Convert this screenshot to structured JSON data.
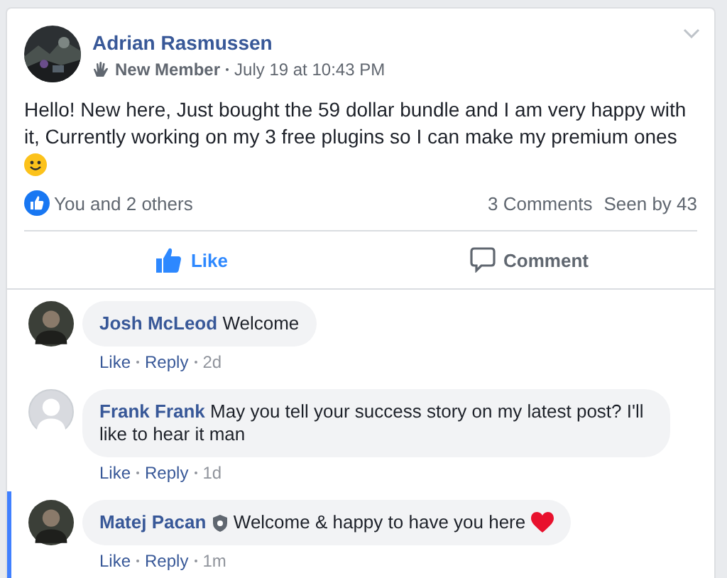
{
  "post": {
    "author": "Adrian Rasmussen",
    "badge": "New Member",
    "time": "July 19 at 10:43 PM",
    "text": "Hello! New here, Just bought the 59 dollar bundle and I am very happy with it, Currently working on my 3 free plugins so I can make my premium ones",
    "reactions": "You and 2 others",
    "comments_count": "3 Comments",
    "seen": "Seen by 43",
    "liked": true,
    "actions": [
      {
        "kind": "like",
        "label": "Like"
      },
      {
        "kind": "comment",
        "label": "Comment"
      }
    ]
  },
  "comments": [
    {
      "author": "Josh McLeod",
      "text": "Welcome",
      "like": "Like",
      "reply": "Reply",
      "age": "2d",
      "highlighted": false,
      "admin": false,
      "heart": false
    },
    {
      "author": "Frank Frank",
      "avatar": {
        "kind": "default"
      },
      "text": "May you tell your success story on my latest post? I'll like to hear it man",
      "like": "Like",
      "reply": "Reply",
      "age": "1d",
      "highlighted": false,
      "admin": false,
      "heart": false
    },
    {
      "author": "Matej Pacan",
      "text": "Welcome & happy to have you here",
      "like": "Like",
      "reply": "Reply",
      "age": "1m",
      "highlighted": true,
      "admin": true,
      "heart": true
    }
  ]
}
